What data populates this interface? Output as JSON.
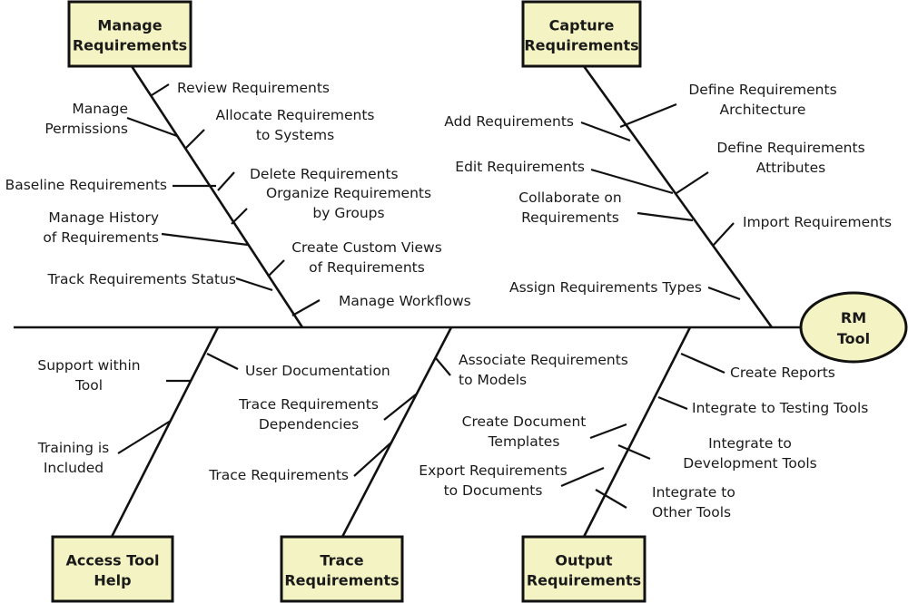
{
  "diagram": {
    "type": "fishbone",
    "effect": {
      "label_lines": [
        "RM",
        "Tool"
      ],
      "fill": "#f4f3c3"
    },
    "category_fill": "#f4f3c3",
    "line_color": "#111111",
    "categories": [
      {
        "id": "manage",
        "label_lines": [
          "Manage",
          "Requirements"
        ],
        "causes": [
          {
            "lines": [
              "Review Requirements"
            ],
            "side": "right"
          },
          {
            "lines": [
              "Manage",
              "Permissions"
            ],
            "side": "left"
          },
          {
            "lines": [
              "Allocate Requirements",
              "to Systems"
            ],
            "side": "right"
          },
          {
            "lines": [
              "Baseline Requirements"
            ],
            "side": "left"
          },
          {
            "lines": [
              "Delete Requirements"
            ],
            "side": "right"
          },
          {
            "lines": [
              "Organize Requirements",
              "by Groups"
            ],
            "side": "right"
          },
          {
            "lines": [
              "Manage History",
              "of Requirements"
            ],
            "side": "left"
          },
          {
            "lines": [
              "Create Custom Views",
              "of Requirements"
            ],
            "side": "right"
          },
          {
            "lines": [
              "Track Requirements Status"
            ],
            "side": "left"
          },
          {
            "lines": [
              "Manage Workflows"
            ],
            "side": "right"
          }
        ]
      },
      {
        "id": "capture",
        "label_lines": [
          "Capture",
          "Requirements"
        ],
        "causes": [
          {
            "lines": [
              "Define Requirements",
              "Architecture"
            ],
            "side": "right"
          },
          {
            "lines": [
              "Add Requirements"
            ],
            "side": "left"
          },
          {
            "lines": [
              "Edit Requirements"
            ],
            "side": "left"
          },
          {
            "lines": [
              "Define Requirements",
              "Attributes"
            ],
            "side": "right"
          },
          {
            "lines": [
              "Collaborate on",
              "Requirements"
            ],
            "side": "left"
          },
          {
            "lines": [
              "Import Requirements"
            ],
            "side": "right"
          },
          {
            "lines": [
              "Assign Requirements Types"
            ],
            "side": "left"
          }
        ]
      },
      {
        "id": "access",
        "label_lines": [
          "Access Tool",
          "Help"
        ],
        "causes": [
          {
            "lines": [
              "User Documentation"
            ],
            "side": "right"
          },
          {
            "lines": [
              "Support within",
              "Tool"
            ],
            "side": "left"
          },
          {
            "lines": [
              "Training is",
              "Included"
            ],
            "side": "left"
          }
        ]
      },
      {
        "id": "trace",
        "label_lines": [
          "Trace",
          "Requirements"
        ],
        "causes": [
          {
            "lines": [
              "Associate Requirements",
              "to Models"
            ],
            "side": "right"
          },
          {
            "lines": [
              "Trace Requirements",
              "Dependencies"
            ],
            "side": "left"
          },
          {
            "lines": [
              "Trace Requirements"
            ],
            "side": "left"
          }
        ]
      },
      {
        "id": "output",
        "label_lines": [
          "Output",
          "Requirements"
        ],
        "causes": [
          {
            "lines": [
              "Create Reports"
            ],
            "side": "right"
          },
          {
            "lines": [
              "Integrate to Testing Tools"
            ],
            "side": "right"
          },
          {
            "lines": [
              "Create Document",
              "Templates"
            ],
            "side": "left"
          },
          {
            "lines": [
              "Integrate to",
              "Development Tools"
            ],
            "side": "right"
          },
          {
            "lines": [
              "Export Requirements",
              "to Documents"
            ],
            "side": "left"
          },
          {
            "lines": [
              "Integrate to",
              "Other Tools"
            ],
            "side": "right"
          }
        ]
      }
    ]
  }
}
